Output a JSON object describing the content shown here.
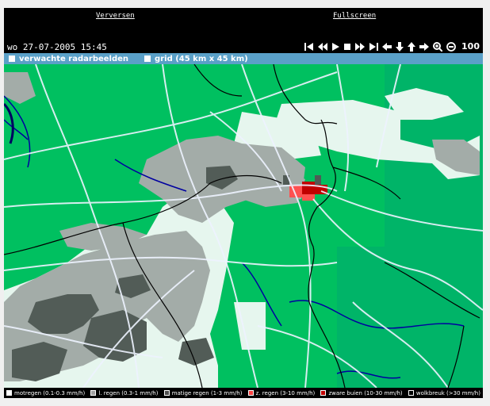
{
  "header": {
    "refresh_label": "Verversen",
    "fullscreen_label": "Fullscreen",
    "timestamp": "wo 27-07-2005 15:45",
    "zoom_level": "100"
  },
  "options": [
    {
      "label": "verwachte radarbeelden"
    },
    {
      "label": "grid (45 km x 45 km)"
    }
  ],
  "legend": [
    {
      "label": "motregen (0.1-0.3 mm/h)",
      "color": "#ffffff"
    },
    {
      "label": "l. regen (0.3-1 mm/h)",
      "color": "#a0a0a0"
    },
    {
      "label": "matige regen (1-3 mm/h)",
      "color": "#505050"
    },
    {
      "label": "z. regen (3-10 mm/h)",
      "color": "#ff4040"
    },
    {
      "label": "zware buien (10-30 mm/h)",
      "color": "#c00000"
    },
    {
      "label": "wolkbreuk (>30 mm/h)",
      "color": "#000000"
    }
  ],
  "colors": {
    "land": "#00c060",
    "sea": "#00b060",
    "drizzle": "#e8f8f0",
    "light_rain": "#a0a8a4",
    "moderate_rain": "#505a55",
    "heavy_rain": "#ff5050",
    "very_heavy": "#c00000",
    "roads": "#e8f0ff",
    "borders": "#000000",
    "rivers": "#0000a0",
    "option_bar": "#5aa0c8"
  }
}
